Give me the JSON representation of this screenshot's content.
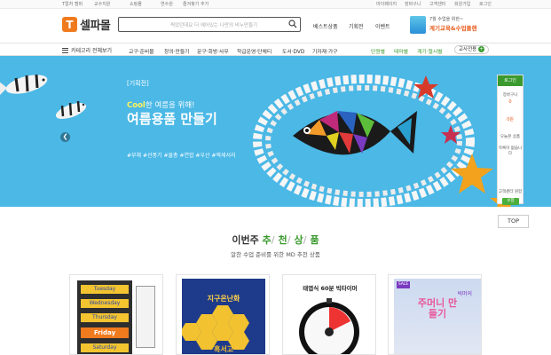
{
  "top_links": {
    "left": [
      "T컬처 캠퍼",
      "교수지원",
      "쇼핑몰",
      "연수원",
      "즐겨찾기 추가"
    ],
    "right": [
      "마이페이지",
      "장바구니",
      "고객센터",
      "회원가입",
      "로그인"
    ]
  },
  "logo": {
    "mark": "T",
    "text": "셀파몰"
  },
  "search": {
    "placeholder": "찍었던데요 더 헤어있는 나만의 비누만들기"
  },
  "header_links": [
    "베스트상품",
    "기획전",
    "이벤트"
  ],
  "promo": {
    "line1": "7월 수업을 위한~",
    "line2": "계기교육&수업플랜"
  },
  "nav": {
    "all": "카테고리 전체보기",
    "items": [
      "교구·준비물",
      "창의·만들기",
      "문구·회방·사무",
      "학급운영·단체티",
      "도서·DVD",
      "기자재·가구"
    ],
    "green_items": [
      "단원별",
      "테마별",
      "계기·절시별"
    ],
    "tag": "교사전용"
  },
  "banner": {
    "tag": "[기획전]",
    "sub_highlight": "Cool",
    "sub_rest": "한 여름을 위해!",
    "title": "여름용품 만들기",
    "hashtags": "#부채 #선풍기 #물총 #연합 #우산 #액세서리",
    "colors": {
      "bg": "#4bb8e6",
      "accent": "#fff35a"
    }
  },
  "sidebar": {
    "login": "로그인",
    "cart_label": "장바구니",
    "cart_count": "0",
    "wish_count": "0원",
    "recent_label": "오늘본 상품",
    "recent_empty": "목록이 없습니다",
    "cs_label": "고객센터 원함",
    "cs_button": "보험"
  },
  "top_button": "TOP",
  "section": {
    "title_pre": "이번주",
    "title_chars": [
      "추",
      "천",
      "상",
      "품"
    ],
    "subtitle": "알찬 수업 준비를 위한 MD 추천 상품"
  },
  "products": [
    {
      "days": [
        "Tuesday",
        "Wednesday",
        "Thursday",
        "Friday",
        "Saturday"
      ]
    },
    {
      "heading": "지구온난화",
      "bottom": "혹서고"
    },
    {
      "heading": "태엽식 60분 빅타이머"
    },
    {
      "badge": "SALE",
      "heading": "빅머의",
      "title": "주머니 만들기"
    }
  ]
}
